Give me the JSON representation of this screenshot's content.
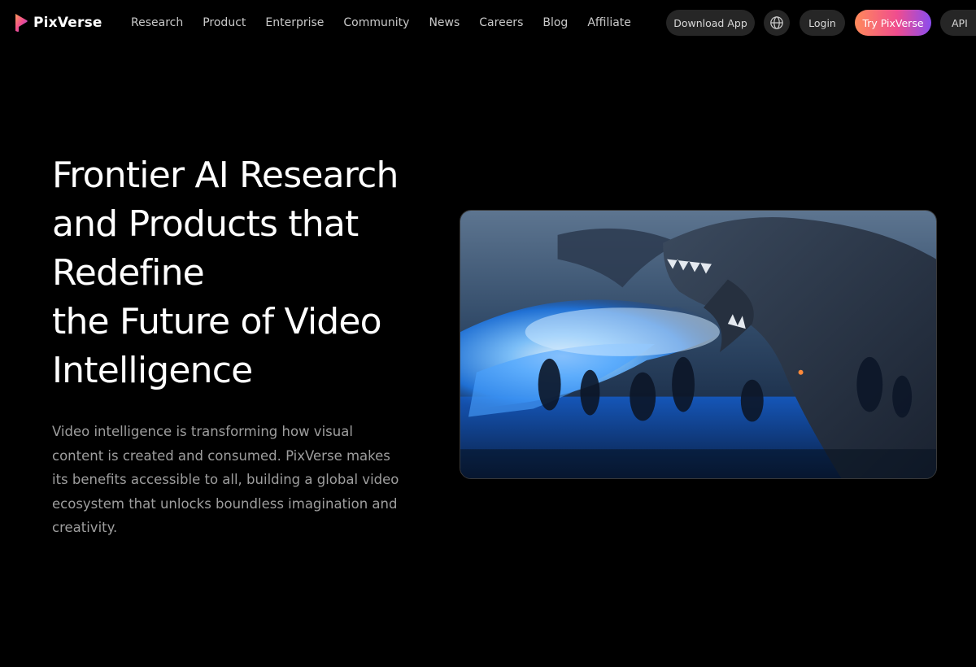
{
  "brand": {
    "name": "PixVerse",
    "accent_gradient": [
      "#ff8a5a",
      "#f04d8e",
      "#8a4cf0"
    ]
  },
  "nav": {
    "items": [
      {
        "label": "Research"
      },
      {
        "label": "Product"
      },
      {
        "label": "Enterprise"
      },
      {
        "label": "Community"
      },
      {
        "label": "News"
      },
      {
        "label": "Careers"
      },
      {
        "label": "Blog"
      },
      {
        "label": "Affiliate"
      }
    ]
  },
  "actions": {
    "download_label": "Download App",
    "language_icon": "globe-icon",
    "login_label": "Login",
    "try_label": "Try PixVerse",
    "api_label": "API"
  },
  "hero": {
    "title_lines": [
      "Frontier AI Research",
      "and Products that",
      "Redefine",
      "the Future of Video",
      "Intelligence"
    ],
    "description": "Video intelligence is transforming how visual content is created and consumed. PixVerse makes its benefits accessible to all, building a global video ecosystem that unlocks boundless imagination and creativity."
  },
  "media": {
    "icon": "dragon-video-image"
  }
}
